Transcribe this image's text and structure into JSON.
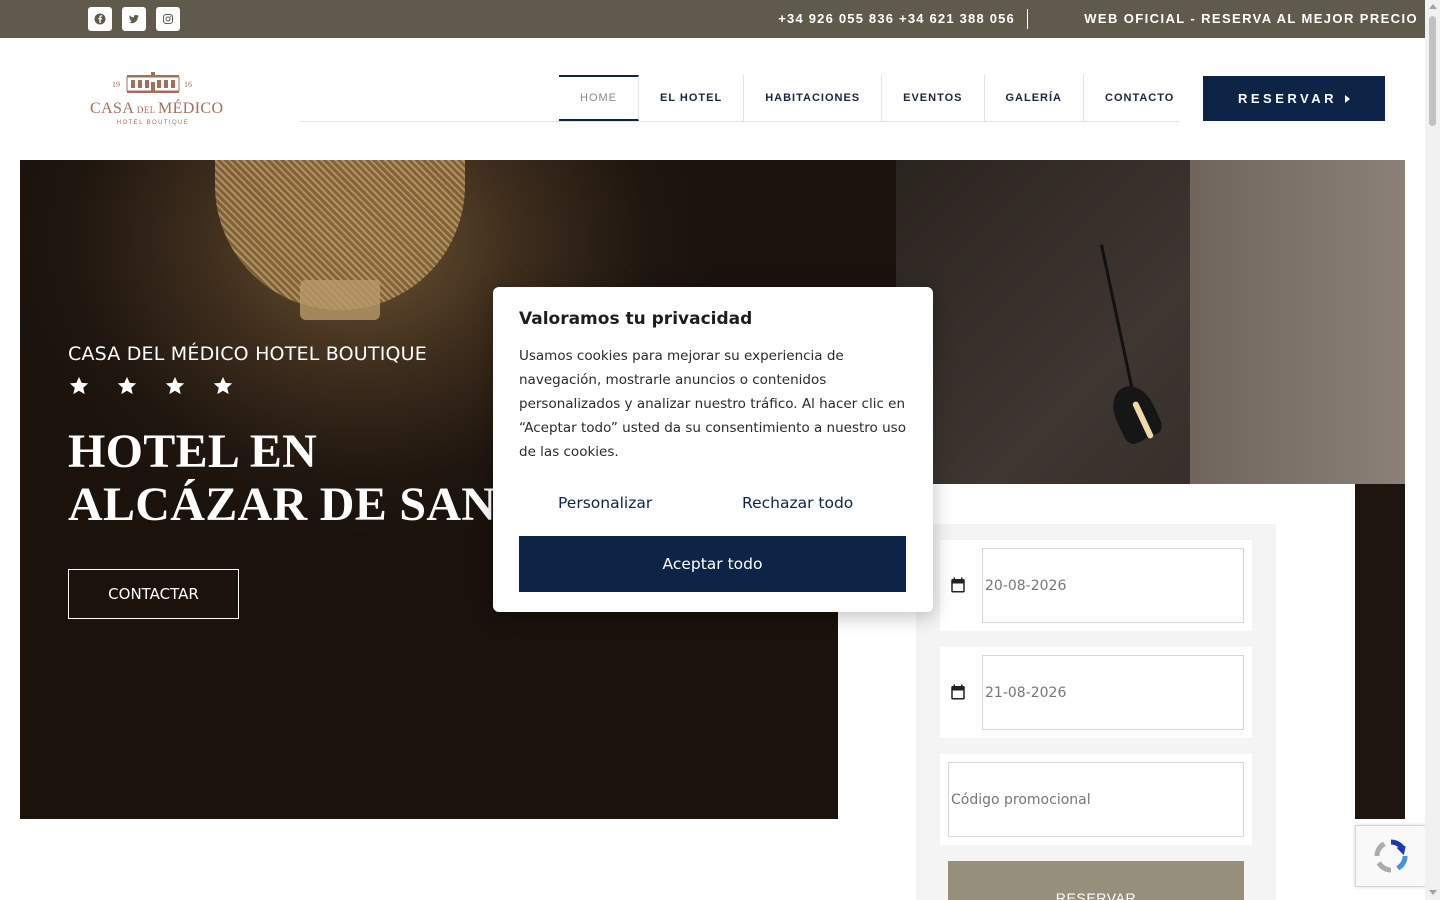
{
  "topbar": {
    "social": [
      {
        "name": "facebook-icon"
      },
      {
        "name": "twitter-icon"
      },
      {
        "name": "instagram-icon"
      }
    ],
    "phones": "+34 926 055 836 +34 621 388 056",
    "official": "WEB OFICIAL - RESERVA AL MEJOR PRECIO"
  },
  "logo": {
    "year_left": "19",
    "year_right": "16",
    "name_main_1": "CASA",
    "name_small": " DEL ",
    "name_main_2": "MÉDICO",
    "subtitle": "HOTEL BOUTIQUE"
  },
  "nav": {
    "items": [
      {
        "label": "HOME",
        "active": true
      },
      {
        "label": "EL HOTEL"
      },
      {
        "label": "HABITACIONES"
      },
      {
        "label": "EVENTOS"
      },
      {
        "label": "GALERÍA"
      },
      {
        "label": "CONTACTO"
      }
    ],
    "reservar": "RESERVAR"
  },
  "hero": {
    "eyebrow": "CASA DEL MÉDICO HOTEL BOUTIQUE",
    "stars": 4,
    "title_line1": "HOTEL EN",
    "title_line2": "ALCÁZAR DE SAN J",
    "cta": "CONTACTAR"
  },
  "booking": {
    "checkin": "20-08-2026",
    "checkout": "21-08-2026",
    "promo_placeholder": "Código promocional",
    "submit": "RESERVAR"
  },
  "cookie": {
    "title": "Valoramos tu privacidad",
    "text": "Usamos cookies para mejorar su experiencia de navegación, mostrarle anuncios o contenidos personalizados y analizar nuestro tráfico. Al hacer clic en “Aceptar todo” usted da su consentimiento a nuestro uso de las cookies.",
    "customize": "Personalizar",
    "reject": "Rechazar todo",
    "accept": "Aceptar todo"
  },
  "colors": {
    "topbar": "#5f5a4b",
    "navy": "#0d2447",
    "logo_brown": "#a0705a",
    "booking_button": "#968f7b"
  }
}
